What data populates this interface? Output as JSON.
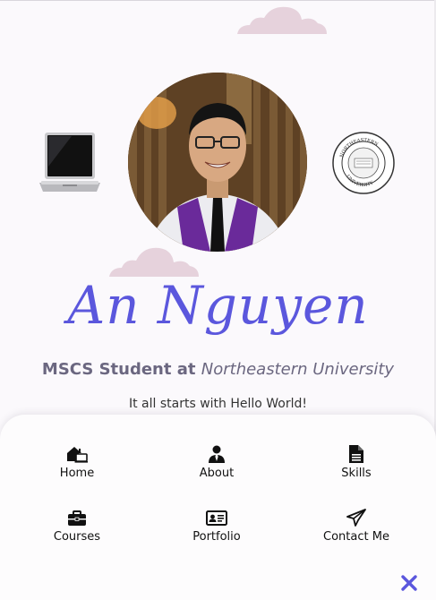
{
  "profile": {
    "name": "An Nguyen",
    "subtitle_prefix": "MSCS Student at ",
    "subtitle_school": "Northeastern University",
    "tagline": "It all starts with Hello World!",
    "badge_text": "NORTHEASTERN UNIVERSITY"
  },
  "nav": {
    "items": [
      {
        "label": "Home",
        "icon": "home-icon"
      },
      {
        "label": "About",
        "icon": "user-icon"
      },
      {
        "label": "Skills",
        "icon": "document-icon"
      },
      {
        "label": "Courses",
        "icon": "briefcase-icon"
      },
      {
        "label": "Portfolio",
        "icon": "id-card-icon"
      },
      {
        "label": "Contact Me",
        "icon": "paper-plane-icon"
      }
    ],
    "close_icon": "close-icon"
  },
  "colors": {
    "accent": "#5b57dd",
    "cloud": "#e6d2dc",
    "subtitle": "#6b6780",
    "background": "#fbf9fc"
  }
}
